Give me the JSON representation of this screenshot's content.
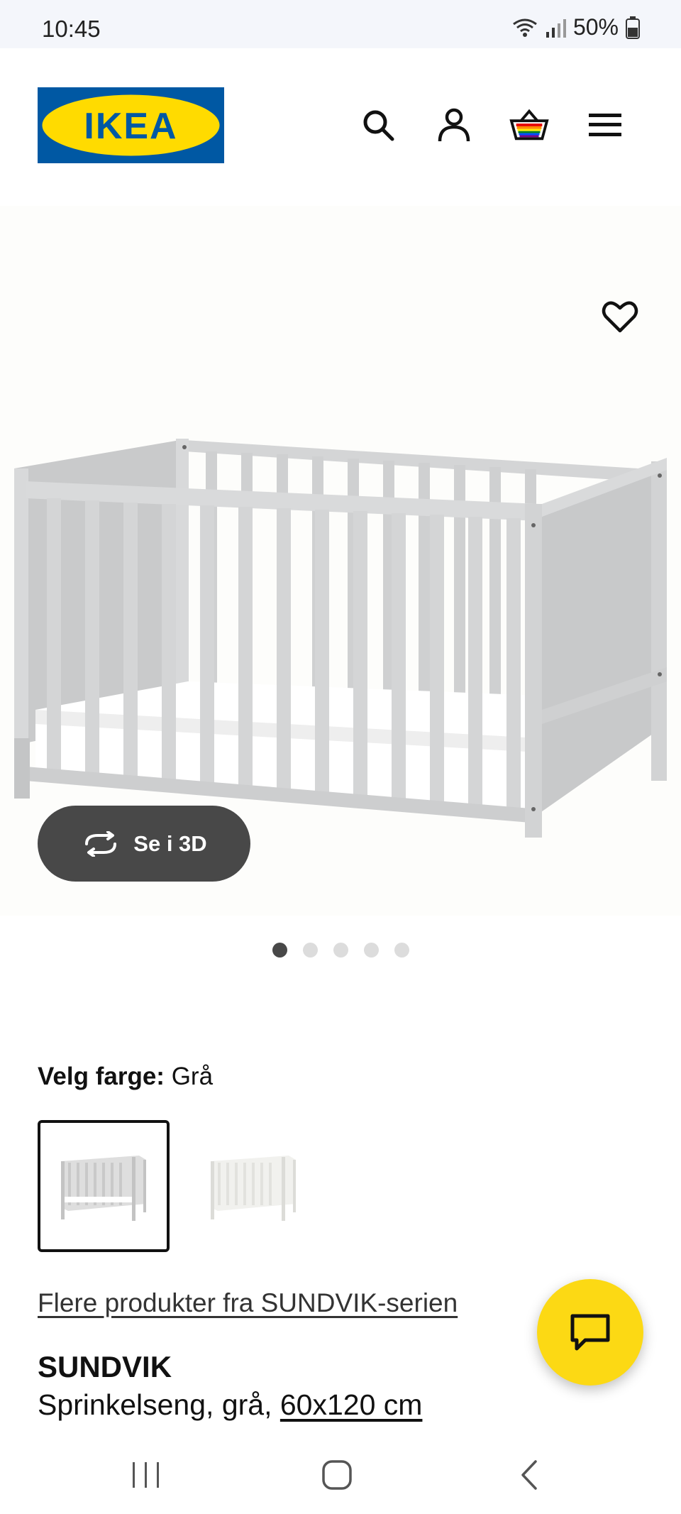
{
  "status_bar": {
    "time": "10:45",
    "battery": "50%"
  },
  "header": {
    "logo_text": "IKEA",
    "brand_colors": {
      "blue": "#0058a3",
      "yellow": "#ffdb00"
    },
    "icons": [
      "search-icon",
      "account-icon",
      "cart-icon",
      "menu-icon"
    ]
  },
  "gallery": {
    "view_3d_label": "Se i 3D",
    "image_count": 5,
    "active_image": 1
  },
  "color_picker": {
    "label": "Velg farge:",
    "selected_value": "Grå",
    "options": [
      "Grå",
      "Hvit"
    ]
  },
  "product": {
    "series_link": "Flere produkter fra SUNDVIK-serien",
    "name": "SUNDVIK",
    "description": "Sprinkelseng, grå,",
    "size": "60x120 cm"
  },
  "colors": {
    "chat_fab": "#fcd914",
    "button_3d": "#484848"
  }
}
